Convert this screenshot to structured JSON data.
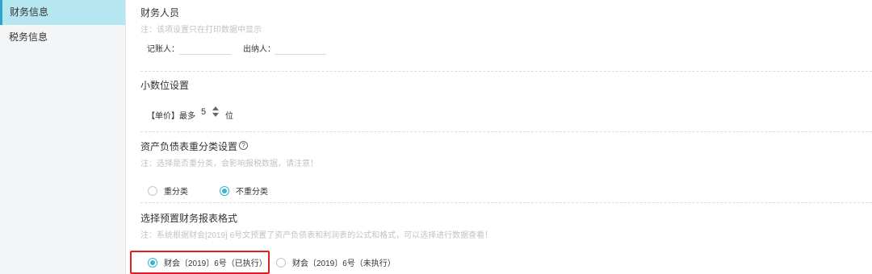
{
  "sidebar": {
    "items": [
      {
        "label": "财务信息",
        "active": true
      },
      {
        "label": "税务信息",
        "active": false
      }
    ]
  },
  "finance_staff": {
    "title": "财务人员",
    "note": "注：该项设置只在打印数据中显示",
    "bookkeeper_label": "记账人：",
    "bookkeeper_value": "",
    "cashier_label": "出纳人：",
    "cashier_value": ""
  },
  "decimal": {
    "title": "小数位设置",
    "prefix": "【单价】最多",
    "value": "5",
    "suffix": "位"
  },
  "reclass": {
    "title": "资产负债表重分类设置",
    "help_icon": "question-circle-icon",
    "note": "注：选择是否重分类，会影响报税数据，请注意！",
    "options": [
      {
        "label": "重分类",
        "checked": false
      },
      {
        "label": "不重分类",
        "checked": true
      }
    ]
  },
  "report_format": {
    "title": "选择预置财务报表格式",
    "note": "注：系统根据财会[2019] 6号文预置了资产负债表和利润表的公式和格式，可以选择进行数据查看！",
    "options": [
      {
        "label": "财会〔2019〕6号（已执行）",
        "checked": true
      },
      {
        "label": "财会〔2019〕6号（未执行）",
        "checked": false
      }
    ]
  },
  "colors": {
    "accent": "#33b5d3",
    "sidebar_active": "#b6e6f0",
    "highlight": "#e02020"
  }
}
